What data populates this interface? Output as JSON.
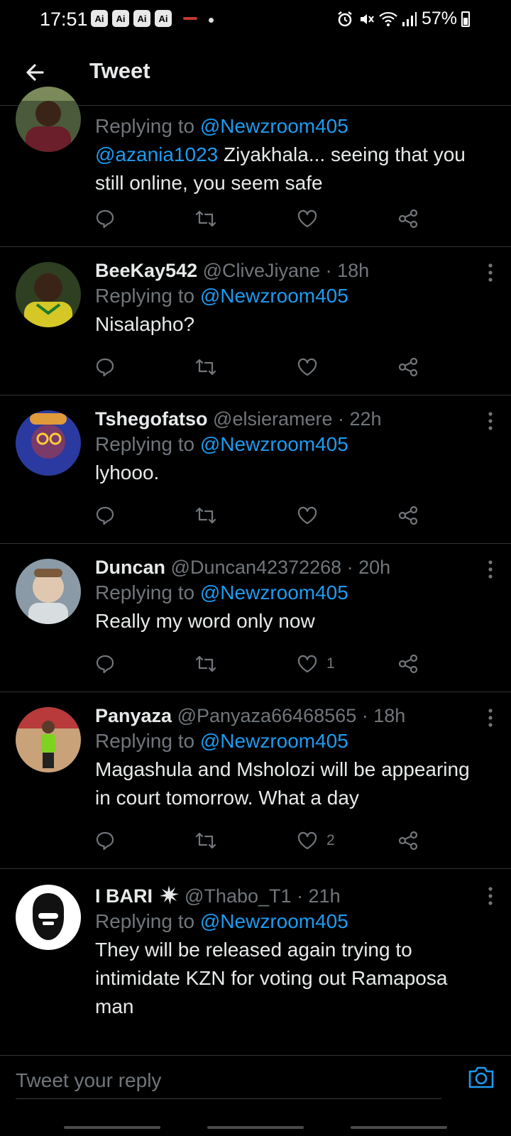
{
  "status_bar": {
    "time": "17:51",
    "ai_badges": [
      "Ai",
      "Ai",
      "Ai",
      "Ai"
    ],
    "battery": "57%"
  },
  "header": {
    "title": "Tweet"
  },
  "tweets": [
    {
      "name": "",
      "handle": "",
      "time": "",
      "replying_prefix": "Replying to",
      "replying_to": "@Newzroom405",
      "mention": "@azania1023",
      "text": " Ziyakhala... seeing that you still online, you seem safe",
      "likes": ""
    },
    {
      "name": "BeeKay542",
      "handle": "@CliveJiyane",
      "time": "· 18h",
      "replying_prefix": "Replying to",
      "replying_to": "@Newzroom405",
      "text": "Nisalapho?",
      "likes": ""
    },
    {
      "name": "Tshegofatso",
      "handle": "@elsieramere",
      "time": "· 22h",
      "replying_prefix": "Replying to",
      "replying_to": "@Newzroom405",
      "text": "lyhooo.",
      "likes": ""
    },
    {
      "name": "Duncan",
      "handle": "@Duncan42372268",
      "time": "· 20h",
      "replying_prefix": "Replying to",
      "replying_to": "@Newzroom405",
      "text": "Really my word only now",
      "likes": "1"
    },
    {
      "name": "Panyaza",
      "handle": "@Panyaza66468565",
      "time": "· 18h",
      "replying_prefix": "Replying to",
      "replying_to": "@Newzroom405",
      "text": "Magashula  and Msholozi will be appearing in court tomorrow. What a day",
      "likes": "2"
    },
    {
      "name": "I BARI",
      "handle": "@Thabo_T1",
      "time": "· 21h",
      "replying_prefix": "Replying to",
      "replying_to": "@Newzroom405",
      "text": "They will be released again trying to intimidate KZN for voting out Ramaposa man",
      "likes": ""
    }
  ],
  "reply_bar": {
    "placeholder": "Tweet your reply"
  },
  "colors": {
    "background": "#000000",
    "text": "#e7e9ea",
    "muted": "#71767b",
    "link": "#1d9bf0",
    "divider": "#2f3336"
  }
}
